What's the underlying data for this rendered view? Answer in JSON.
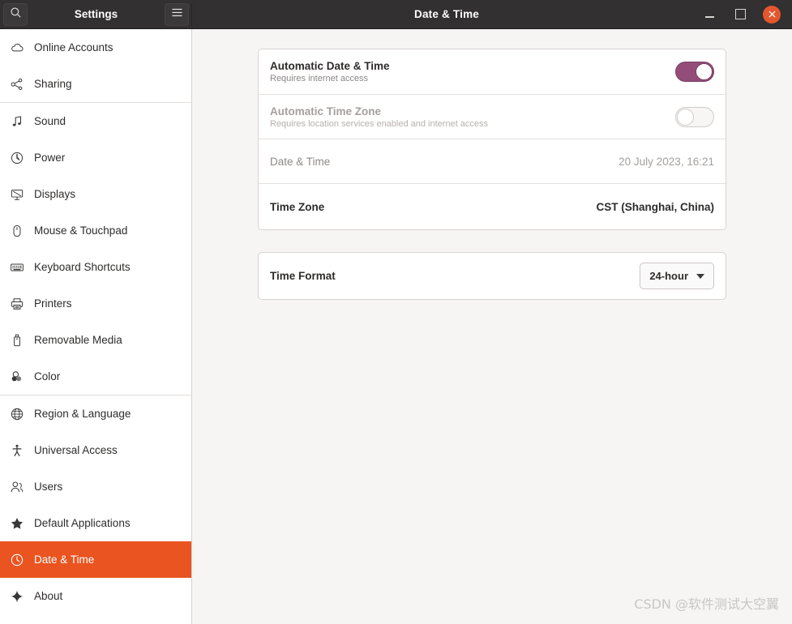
{
  "window": {
    "sidebar_title": "Settings",
    "page_title": "Date & Time",
    "search_icon": "search-icon",
    "menu_icon": "hamburger-menu-icon",
    "minimize_label": "–",
    "maximize_label": "□",
    "close_label": "✕",
    "accent_color": "#e95420",
    "titlebar_color": "#323031",
    "toggle_on_color": "#924d79"
  },
  "sidebar": {
    "items": [
      {
        "label": "Online Accounts",
        "icon": "cloud-icon",
        "selected": false,
        "separator_after": false
      },
      {
        "label": "Sharing",
        "icon": "share-nodes-icon",
        "selected": false,
        "separator_after": true
      },
      {
        "label": "Sound",
        "icon": "music-note-icon",
        "selected": false,
        "separator_after": false
      },
      {
        "label": "Power",
        "icon": "power-icon",
        "selected": false,
        "separator_after": false
      },
      {
        "label": "Displays",
        "icon": "monitor-icon",
        "selected": false,
        "separator_after": false
      },
      {
        "label": "Mouse & Touchpad",
        "icon": "mouse-icon",
        "selected": false,
        "separator_after": false
      },
      {
        "label": "Keyboard Shortcuts",
        "icon": "keyboard-icon",
        "selected": false,
        "separator_after": false
      },
      {
        "label": "Printers",
        "icon": "printer-icon",
        "selected": false,
        "separator_after": false
      },
      {
        "label": "Removable Media",
        "icon": "usb-drive-icon",
        "selected": false,
        "separator_after": false
      },
      {
        "label": "Color",
        "icon": "color-circles-icon",
        "selected": false,
        "separator_after": true
      },
      {
        "label": "Region & Language",
        "icon": "globe-icon",
        "selected": false,
        "separator_after": false
      },
      {
        "label": "Universal Access",
        "icon": "accessibility-person-icon",
        "selected": false,
        "separator_after": false
      },
      {
        "label": "Users",
        "icon": "users-icon",
        "selected": false,
        "separator_after": false
      },
      {
        "label": "Default Applications",
        "icon": "star-icon",
        "selected": false,
        "separator_after": false
      },
      {
        "label": "Date & Time",
        "icon": "clock-icon",
        "selected": true,
        "separator_after": false
      },
      {
        "label": "About",
        "icon": "sparkle-icon",
        "selected": false,
        "separator_after": false
      }
    ]
  },
  "main": {
    "card1": {
      "auto_datetime": {
        "title": "Automatic Date & Time",
        "subtitle": "Requires internet access",
        "toggle_state": "on"
      },
      "auto_timezone": {
        "title": "Automatic Time Zone",
        "subtitle": "Requires location services enabled and internet access",
        "toggle_state": "off"
      },
      "datetime": {
        "title": "Date & Time",
        "value": "20 July 2023, 16:21"
      },
      "timezone": {
        "title": "Time Zone",
        "value": "CST (Shanghai, China)"
      }
    },
    "card2": {
      "time_format": {
        "title": "Time Format",
        "value": "24-hour"
      }
    }
  },
  "watermark": "CSDN @软件测试大空翼"
}
